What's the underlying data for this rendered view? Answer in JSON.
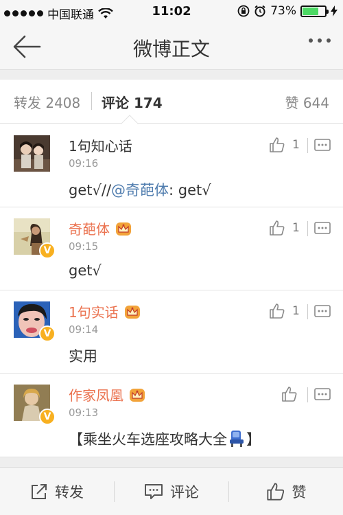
{
  "status_bar": {
    "carrier": "中国联通",
    "time": "11:02",
    "battery": "73%",
    "battery_level": 0.73,
    "icons": [
      "signal-dots-icon",
      "wifi-icon",
      "orientation-lock-icon",
      "alarm-icon",
      "battery-icon",
      "charging-icon"
    ]
  },
  "nav": {
    "title": "微博正文",
    "back_icon": "back-arrow-icon",
    "more_icon": "more-dots-icon"
  },
  "tabs": {
    "repost": "转发 2408",
    "comment_label": "评论",
    "comment_count": "174",
    "like": "赞 644"
  },
  "comments": [
    {
      "name": "1句知心话",
      "verified": false,
      "crown": false,
      "time": "09:16",
      "text_before": "get√//",
      "mention": "@奇葩体",
      "text_after": ": get√",
      "likes": "1"
    },
    {
      "name": "奇葩体",
      "verified": true,
      "crown": true,
      "time": "09:15",
      "text": "get√",
      "likes": "1"
    },
    {
      "name": "1句实话",
      "verified": true,
      "crown": true,
      "time": "09:14",
      "text": "实用",
      "likes": "1"
    },
    {
      "name": "作家凤凰",
      "verified": true,
      "crown": true,
      "time": "09:13",
      "text": "【乘坐火车选座攻略大全",
      "text_suffix": "】",
      "likes": ""
    }
  ],
  "badge": {
    "v": "V"
  },
  "colors": {
    "accent_orange": "#eb7350",
    "mention_blue": "#4f7cae",
    "verified_gold": "#f8b020",
    "battery_green": "#4cd964"
  },
  "toolbar": {
    "repost": "转发",
    "comment": "评论",
    "like": "赞"
  }
}
